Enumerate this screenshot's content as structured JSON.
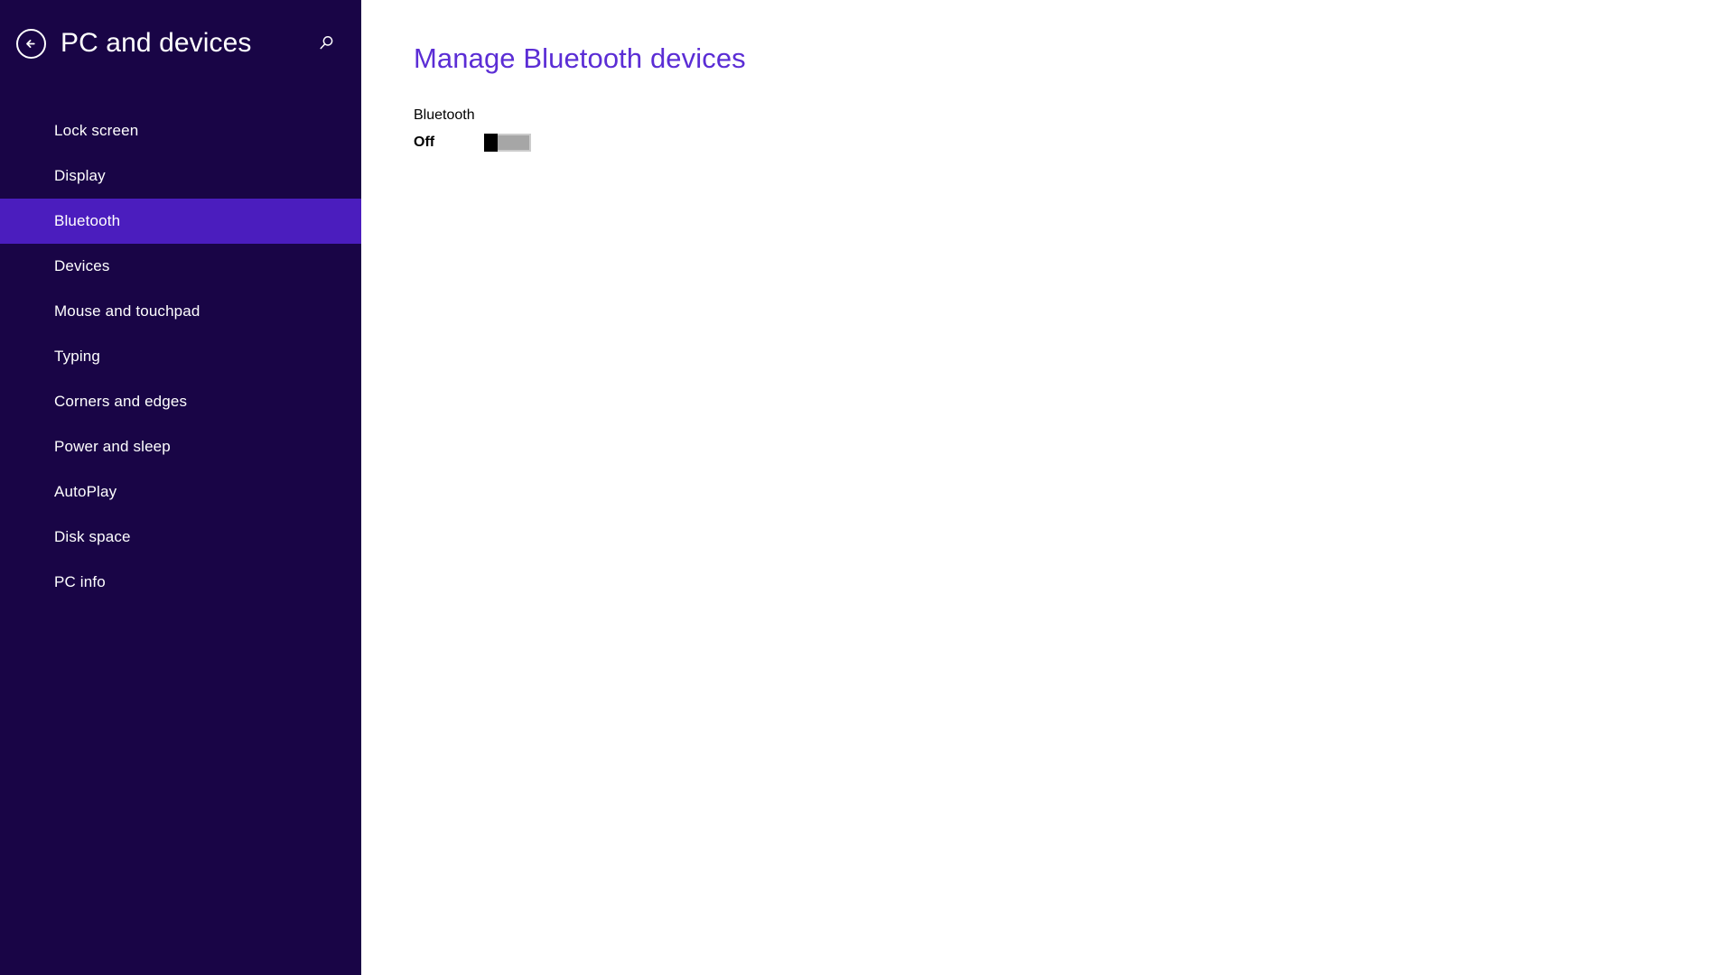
{
  "sidebar": {
    "title": "PC and devices",
    "back_icon": "back-arrow-circle-icon",
    "search_icon": "search-icon",
    "accent_selected": "#4B1DBE",
    "background": "#190546",
    "items": [
      {
        "label": "Lock screen",
        "selected": false
      },
      {
        "label": "Display",
        "selected": false
      },
      {
        "label": "Bluetooth",
        "selected": true
      },
      {
        "label": "Devices",
        "selected": false
      },
      {
        "label": "Mouse and touchpad",
        "selected": false
      },
      {
        "label": "Typing",
        "selected": false
      },
      {
        "label": "Corners and edges",
        "selected": false
      },
      {
        "label": "Power and sleep",
        "selected": false
      },
      {
        "label": "AutoPlay",
        "selected": false
      },
      {
        "label": "Disk space",
        "selected": false
      },
      {
        "label": "PC info",
        "selected": false
      }
    ]
  },
  "main": {
    "page_title": "Manage Bluetooth devices",
    "page_title_color": "#5B2DD5",
    "bluetooth": {
      "label": "Bluetooth",
      "state_label": "Off",
      "toggle_on": false,
      "thumb_color": "#000000",
      "track_color": "#a6a6a6"
    }
  }
}
